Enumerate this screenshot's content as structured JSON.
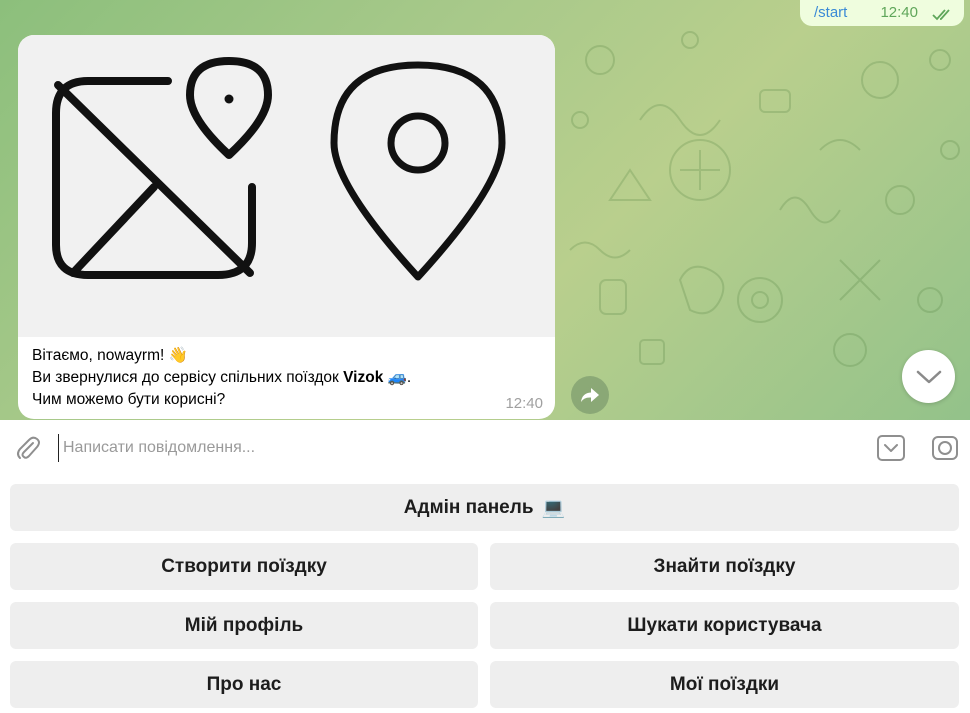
{
  "outgoing_message": {
    "text": "/start",
    "time": "12:40"
  },
  "incoming_message": {
    "line1": "Вітаємо, nowayrm! 👋",
    "line2_prefix": "Ви звернулися до сервісу спільних поїздок ",
    "line2_bold": "Vizok",
    "line2_suffix": " 🚙.",
    "line3": "Чим можемо бути корисні?",
    "time": "12:40"
  },
  "input": {
    "placeholder": "Написати повідомлення..."
  },
  "keyboard": {
    "admin": "Адмін панель",
    "admin_emoji": "💻",
    "create_trip": "Створити поїздку",
    "find_trip": "Знайти поїздку",
    "my_profile": "Мій профіль",
    "search_user": "Шукати користувача",
    "about": "Про нас",
    "my_trips": "Мої поїздки"
  },
  "icons": {
    "media_left": "image-location-icon",
    "media_right": "map-pin-icon",
    "share": "share-icon",
    "scroll_down": "chevron-down-icon",
    "attach": "paperclip-icon",
    "keyboard": "keyboard-toggle-icon",
    "camera": "camera-icon",
    "read": "double-check-icon"
  },
  "colors": {
    "outgoing_bubble": "#effdde",
    "link": "#3a8ad6",
    "read_ticks": "#5fa65a",
    "keyboard_button": "#eeeeee"
  }
}
